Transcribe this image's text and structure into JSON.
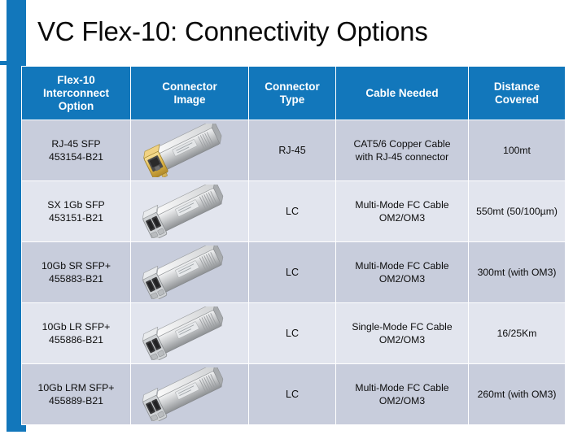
{
  "slide": {
    "title": "VC Flex-10: Connectivity Options",
    "accent_color": "#1277bb",
    "row_dark_color": "#c8cddc",
    "row_light_color": "#e2e5ee",
    "header_text_color": "#ffffff"
  },
  "table": {
    "headers": [
      "Flex-10 Interconnect Option",
      "Connector Image",
      "Connector Type",
      "Cable Needed",
      "Distance Covered"
    ],
    "header_lines": [
      [
        "Flex-10",
        "Interconnect",
        "Option"
      ],
      [
        "Connector",
        "Image"
      ],
      [
        "Connector",
        "Type"
      ],
      [
        "Cable Needed"
      ],
      [
        "Distance",
        "Covered"
      ]
    ],
    "rows": [
      {
        "option_line1": "RJ-45 SFP",
        "option_line2": "453154-B21",
        "connector_image": "rj45-sfp-module-icon",
        "connector_type": "RJ-45",
        "cable_line1": "CAT5/6 Copper Cable",
        "cable_line2": "with RJ-45 connector",
        "distance": "100mt"
      },
      {
        "option_line1": "SX 1Gb SFP",
        "option_line2": "453151-B21",
        "connector_image": "lc-sfp-module-icon",
        "connector_type": "LC",
        "cable_line1": "Multi-Mode FC Cable",
        "cable_line2": "OM2/OM3",
        "distance": "550mt (50/100µm)"
      },
      {
        "option_line1": "10Gb SR SFP+",
        "option_line2": "455883-B21",
        "connector_image": "lc-sfp-module-icon",
        "connector_type": "LC",
        "cable_line1": "Multi-Mode FC Cable",
        "cable_line2": "OM2/OM3",
        "distance": "300mt (with OM3)"
      },
      {
        "option_line1": "10Gb LR SFP+",
        "option_line2": "455886-B21",
        "connector_image": "lc-sfp-module-icon",
        "connector_type": "LC",
        "cable_line1": "Single-Mode FC Cable",
        "cable_line2": "OM2/OM3",
        "distance": "16/25Km"
      },
      {
        "option_line1": "10Gb LRM SFP+",
        "option_line2": "455889-B21",
        "connector_image": "lc-sfp-module-icon",
        "connector_type": "LC",
        "cable_line1": "Multi-Mode FC Cable",
        "cable_line2": "OM2/OM3",
        "distance": "260mt (with OM3)"
      }
    ]
  }
}
